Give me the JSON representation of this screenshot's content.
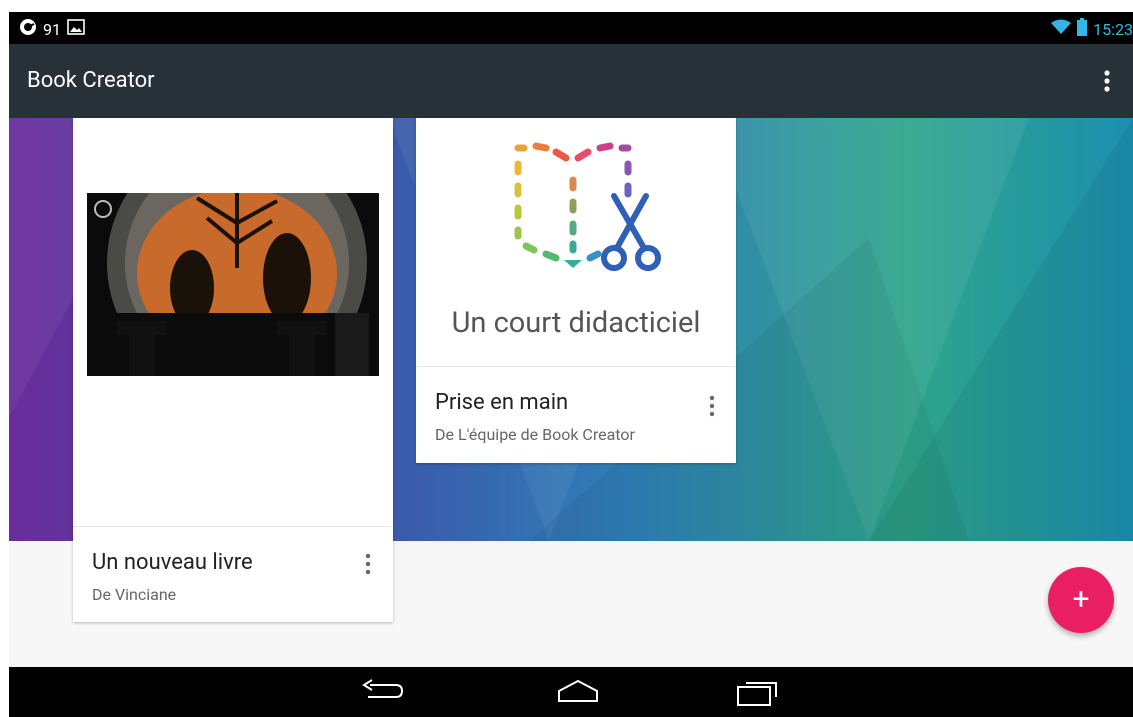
{
  "status_bar": {
    "notification_count": "91",
    "time": "15:23",
    "icons": [
      "app-notification-icon",
      "image-notification-icon",
      "wifi-icon",
      "battery-icon"
    ]
  },
  "app_bar": {
    "title": "Book Creator",
    "overflow_icon": "more-vert-icon"
  },
  "books": [
    {
      "title": "Un nouveau livre",
      "author": "De Vinciane",
      "cover": "greek-vase-illustration"
    },
    {
      "title": "Prise en main",
      "author": "De L'équipe de Book Creator",
      "cover_text": "Un court didacticiel",
      "cover": "book-creator-logo"
    }
  ],
  "fab": {
    "label": "+",
    "icon": "add-icon",
    "color": "#e91e63"
  },
  "nav_bar": {
    "buttons": [
      "back-icon",
      "home-icon",
      "recents-icon"
    ]
  },
  "colors": {
    "app_bar": "#263238",
    "accent": "#e91e63",
    "status_clock": "#33b5e5"
  }
}
